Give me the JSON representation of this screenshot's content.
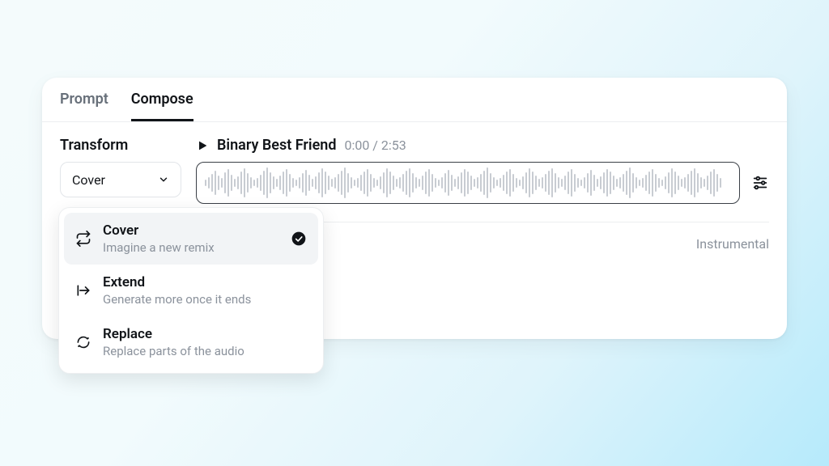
{
  "tabs": {
    "prompt": "Prompt",
    "compose": "Compose"
  },
  "transform": {
    "label": "Transform",
    "selected": "Cover"
  },
  "track": {
    "title": "Binary Best Friend",
    "time": "0:00 / 2:53"
  },
  "badge": "Instrumental",
  "dropdown": {
    "items": [
      {
        "title": "Cover",
        "desc": "Imagine a new remix",
        "selected": true
      },
      {
        "title": "Extend",
        "desc": "Generate more once it ends",
        "selected": false
      },
      {
        "title": "Replace",
        "desc": "Replace parts of the audio",
        "selected": false
      }
    ]
  }
}
